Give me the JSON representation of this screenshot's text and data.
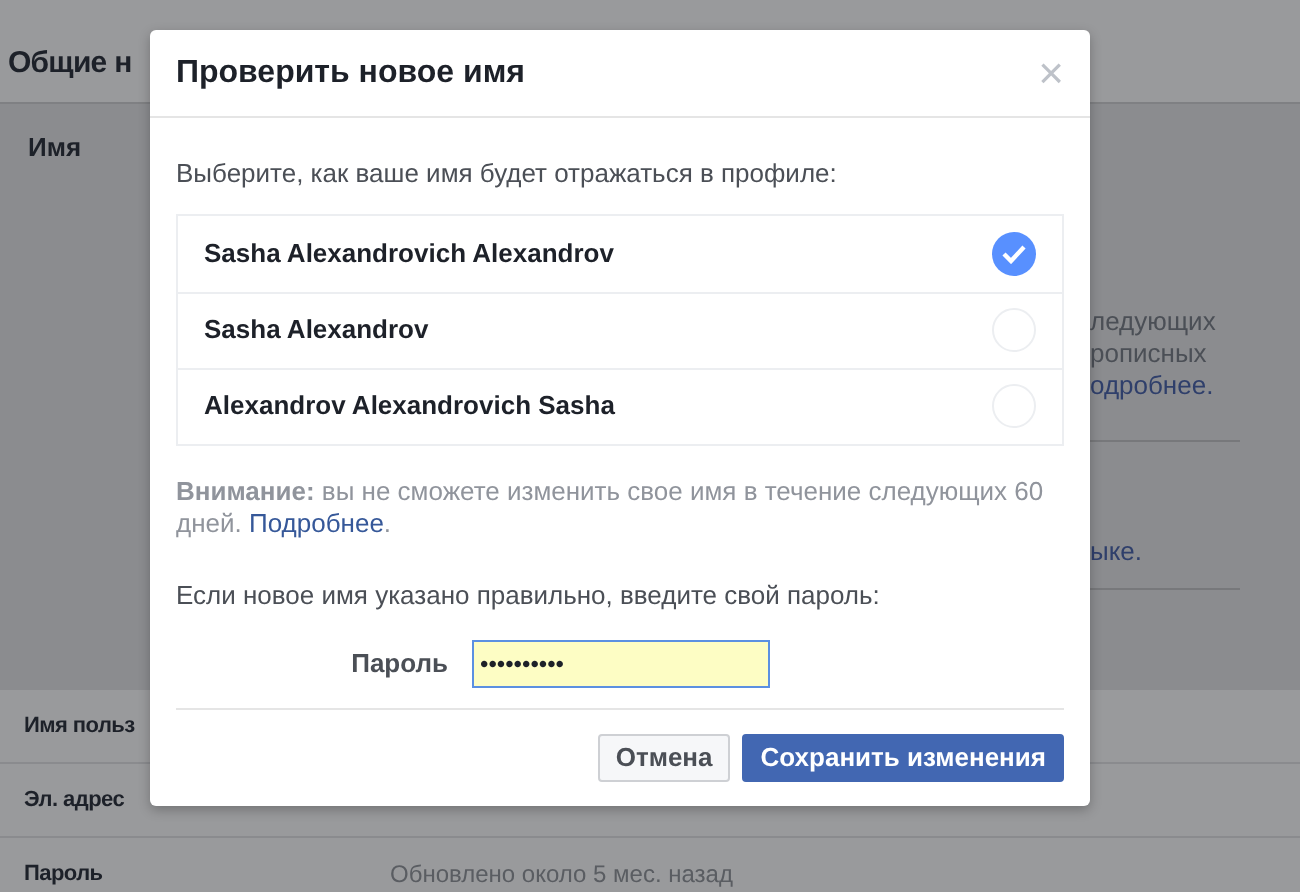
{
  "page": {
    "title": "Общие н",
    "name_label": "Имя",
    "name_fragments": [
      "ледующих",
      "рописных"
    ],
    "name_link": "одробнее.",
    "lang_fragment": "ыке.",
    "rows": [
      {
        "label": "Имя польз",
        "value": ""
      },
      {
        "label": "Эл. адрес",
        "value": ""
      },
      {
        "label": "Пароль",
        "value": "Обновлено около 5 мес. назад"
      }
    ]
  },
  "dialog": {
    "title": "Проверить новое имя",
    "close": "×",
    "prompt": "Выберите, как ваше имя будет отражаться в профиле:",
    "options": [
      {
        "label": "Sasha Alexandrovich Alexandrov",
        "selected": true
      },
      {
        "label": "Sasha Alexandrov",
        "selected": false
      },
      {
        "label": "Alexandrov Alexandrovich Sasha",
        "selected": false
      }
    ],
    "warning": "**Внимание:** вы не сможете изменить свое имя в течение следующих 60 дней.",
    "warning_link": "Подробнее",
    "warning_end": ".",
    "password_prompt": "Если новое имя указано правильно, введите свой пароль:",
    "password_label": "Пароль",
    "password_value": "••••••••••",
    "buttons": [
      {
        "label": "Отмена",
        "kind": "secondary"
      },
      {
        "label": "Сохранить изменения",
        "kind": "primary"
      }
    ]
  }
}
